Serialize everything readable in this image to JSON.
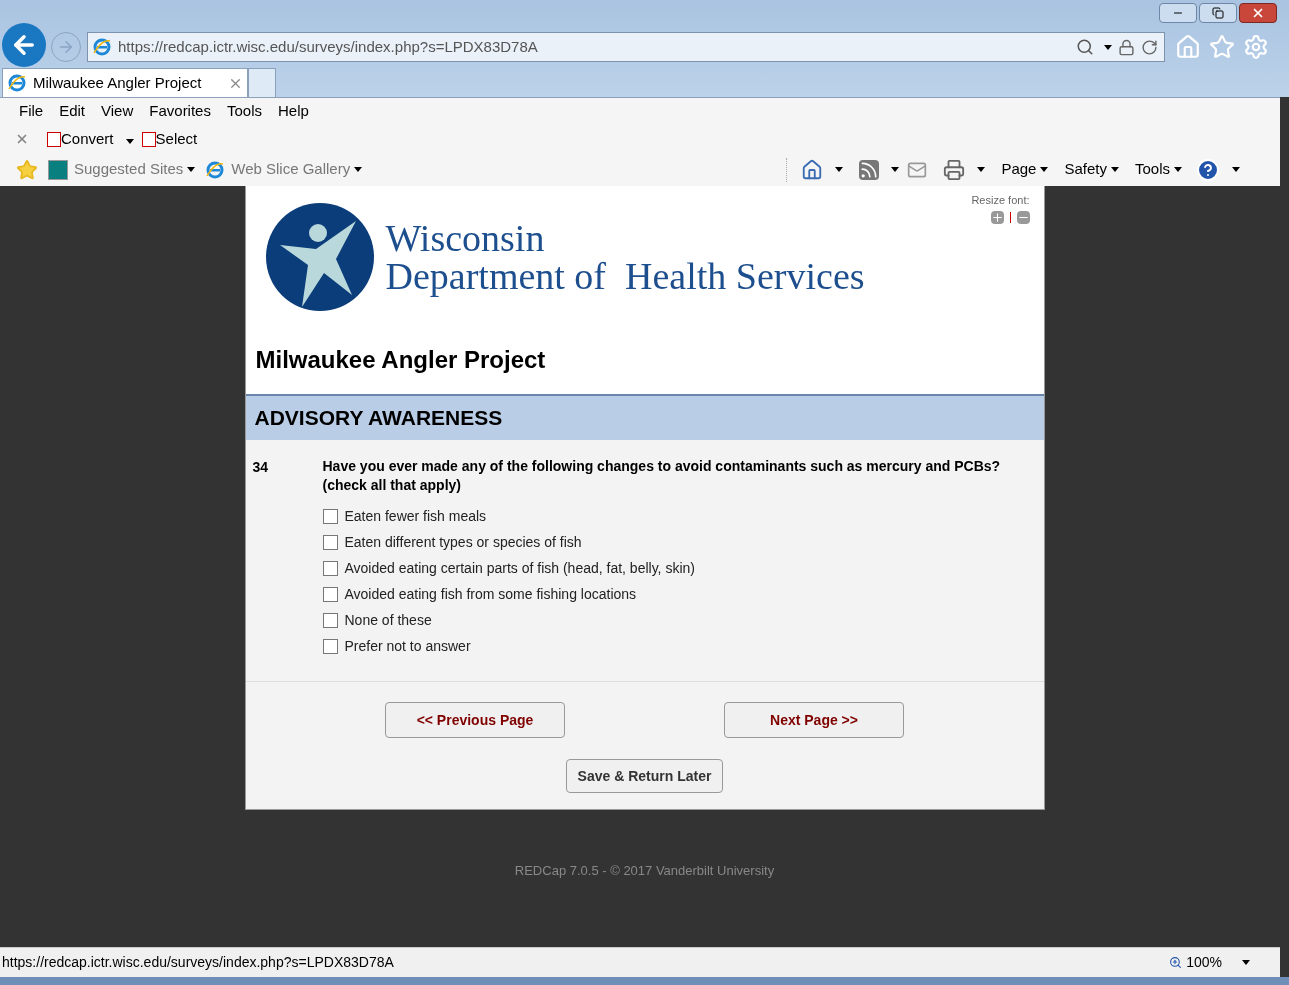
{
  "browser": {
    "address": "https://redcap.ictr.wisc.edu/surveys/index.php?s=LPDX83D78A",
    "tab": {
      "title": "Milwaukee Angler Project",
      "selected": true
    },
    "menu": [
      "File",
      "Edit",
      "View",
      "Favorites",
      "Tools",
      "Help"
    ],
    "addons": [
      {
        "label": "Convert",
        "dropdown": true
      },
      {
        "label": "Select",
        "dropdown": false
      }
    ],
    "favorites": [
      {
        "label": "Suggested Sites"
      },
      {
        "label": "Web Slice Gallery"
      }
    ],
    "commands": [
      "Page",
      "Safety",
      "Tools"
    ]
  },
  "page": {
    "resize_label": "Resize font:",
    "logo": {
      "line1": "Wisconsin",
      "line2": "Department of  Health Services"
    },
    "title": "Milwaukee Angler Project",
    "section": "ADVISORY AWARENESS",
    "question": {
      "number": "34",
      "text": "Have you ever made any of the following changes to avoid contaminants such as mercury and PCBs? (check all that apply)",
      "options": [
        {
          "label": "Eaten fewer fish meals",
          "checked": false
        },
        {
          "label": "Eaten different types or species of fish",
          "checked": false
        },
        {
          "label": "Avoided eating certain parts of fish (head, fat, belly, skin)",
          "checked": false
        },
        {
          "label": "Avoided eating fish from some fishing locations",
          "checked": false
        },
        {
          "label": "None of these",
          "checked": false
        },
        {
          "label": "Prefer not to answer",
          "checked": false
        }
      ]
    },
    "buttons": {
      "previous": "<< Previous Page",
      "next": "Next Page >>",
      "save": "Save & Return Later"
    },
    "footer": "REDCap 7.0.5 - © 2017 Vanderbilt University"
  },
  "status_bar": {
    "url": "https://redcap.ictr.wisc.edu/surveys/index.php?s=LPDX83D78A",
    "zoom": "100%"
  }
}
